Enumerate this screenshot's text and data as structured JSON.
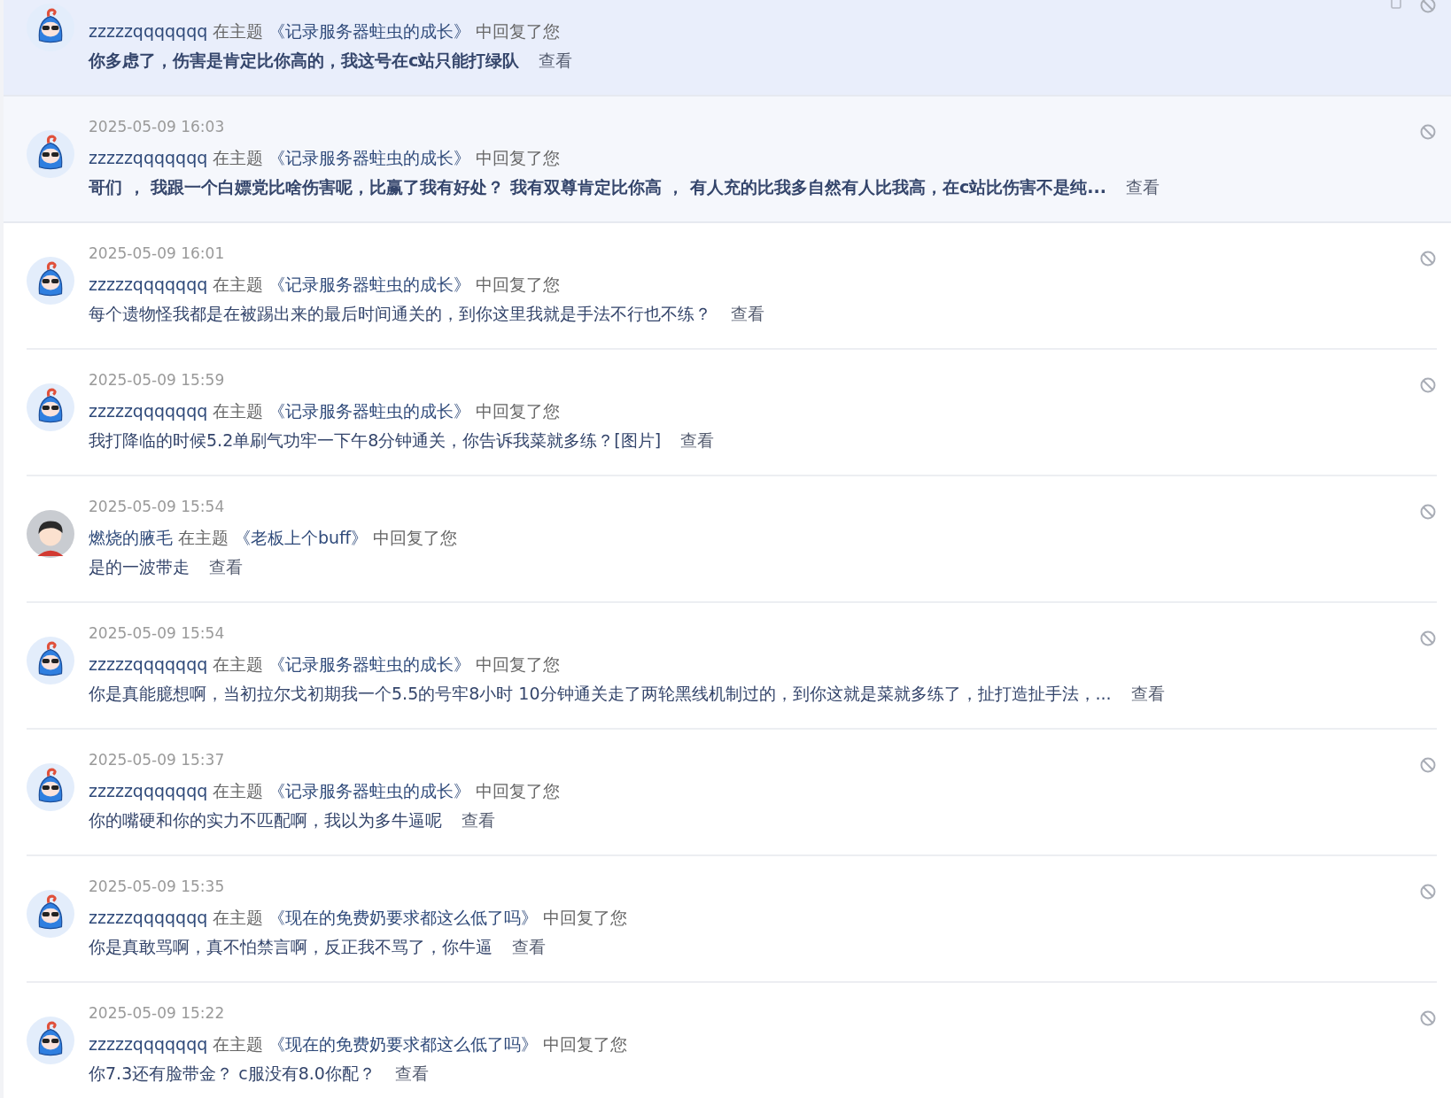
{
  "notifications": [
    {
      "user": "zzzzzqqqqqqq",
      "prefix": "在主题",
      "topic": "《记录服务器蛀虫的成长》",
      "suffix": "中回复了您",
      "content": "你多虑了，伤害是肯定比你高的，我这号在c站只能打绿队",
      "view": "查看",
      "unread": true,
      "hovered": true,
      "kind": "mascot"
    },
    {
      "time": "2025-05-09 16:03",
      "user": "zzzzzqqqqqqq",
      "prefix": "在主题",
      "topic": "《记录服务器蛀虫的成长》",
      "suffix": "中回复了您",
      "content": "哥们 ， 我跟一个白嫖党比啥伤害呢，比赢了我有好处？   我有双尊肯定比你高 ， 有人充的比我多自然有人比我高，在c站比伤害不是纯...",
      "view": "查看",
      "unread": true,
      "hovered": false,
      "kind": "mascot"
    },
    {
      "time": "2025-05-09 16:01",
      "user": "zzzzzqqqqqqq",
      "prefix": "在主题",
      "topic": "《记录服务器蛀虫的成长》",
      "suffix": "中回复了您",
      "content": "每个遗物怪我都是在被踢出来的最后时间通关的，到你这里我就是手法不行也不练？",
      "view": "查看",
      "unread": false,
      "hovered": false,
      "kind": "mascot"
    },
    {
      "time": "2025-05-09 15:59",
      "user": "zzzzzqqqqqqq",
      "prefix": "在主题",
      "topic": "《记录服务器蛀虫的成长》",
      "suffix": "中回复了您",
      "content": "我打降临的时候5.2单刷气功牢一下午8分钟通关，你告诉我菜就多练？[图片]",
      "view": "查看",
      "unread": false,
      "hovered": false,
      "kind": "mascot"
    },
    {
      "time": "2025-05-09 15:54",
      "user": "燃烧的腋毛",
      "prefix": "在主题",
      "topic": "《老板上个buff》",
      "suffix": "中回复了您",
      "content": "是的一波带走",
      "view": "查看",
      "unread": false,
      "hovered": false,
      "kind": "person"
    },
    {
      "time": "2025-05-09 15:54",
      "user": "zzzzzqqqqqqq",
      "prefix": "在主题",
      "topic": "《记录服务器蛀虫的成长》",
      "suffix": "中回复了您",
      "content": "你是真能臆想啊，当初拉尔戈初期我一个5.5的号牢8小时 10分钟通关走了两轮黑线机制过的，到你这就是菜就多练了，扯打造扯手法，...",
      "view": "查看",
      "unread": false,
      "hovered": false,
      "kind": "mascot"
    },
    {
      "time": "2025-05-09 15:37",
      "user": "zzzzzqqqqqqq",
      "prefix": "在主题",
      "topic": "《记录服务器蛀虫的成长》",
      "suffix": "中回复了您",
      "content": "你的嘴硬和你的实力不匹配啊，我以为多牛逼呢",
      "view": "查看",
      "unread": false,
      "hovered": false,
      "kind": "mascot"
    },
    {
      "time": "2025-05-09 15:35",
      "user": "zzzzzqqqqqqq",
      "prefix": "在主题",
      "topic": "《现在的免费奶要求都这么低了吗》",
      "suffix": "中回复了您",
      "content": "你是真敢骂啊，真不怕禁言啊，反正我不骂了，你牛逼",
      "view": "查看",
      "unread": false,
      "hovered": false,
      "kind": "mascot"
    },
    {
      "time": "2025-05-09 15:22",
      "user": "zzzzzqqqqqqq",
      "prefix": "在主题",
      "topic": "《现在的免费奶要求都这么低了吗》",
      "suffix": "中回复了您",
      "content": "你7.3还有脸带金？   c服没有8.0你配？",
      "view": "查看",
      "unread": false,
      "hovered": false,
      "kind": "mascot"
    }
  ]
}
